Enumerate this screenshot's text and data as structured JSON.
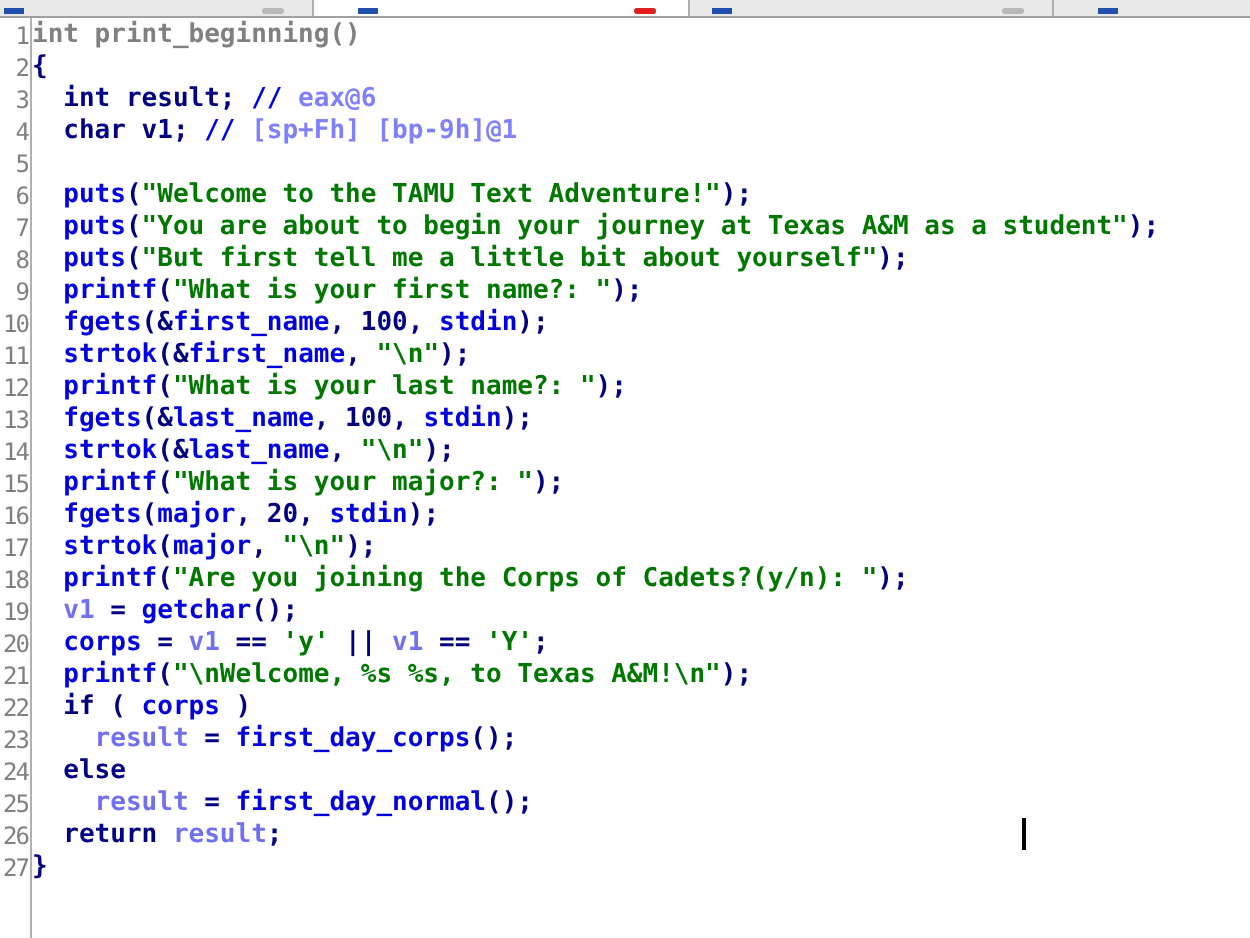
{
  "tabs": [
    {
      "selected": false,
      "closable": true
    },
    {
      "selected": true,
      "closable": true
    },
    {
      "selected": false,
      "closable": true
    },
    {
      "selected": false,
      "closable": false
    }
  ],
  "code_lines": [
    {
      "number": "1",
      "tokens": [
        {
          "kind": "decl",
          "text": "int print_beginning()"
        }
      ]
    },
    {
      "number": "2",
      "tokens": [
        {
          "kind": "plain",
          "text": "{"
        }
      ]
    },
    {
      "number": "3",
      "tokens": [
        {
          "kind": "plain",
          "text": "  int result; "
        },
        {
          "kind": "func",
          "text": "//"
        },
        {
          "kind": "comment",
          "text": " eax@6"
        }
      ]
    },
    {
      "number": "4",
      "tokens": [
        {
          "kind": "plain",
          "text": "  char v1; "
        },
        {
          "kind": "func",
          "text": "//"
        },
        {
          "kind": "comment",
          "text": " [sp+Fh] [bp-9h]@1"
        }
      ]
    },
    {
      "number": "5"
    },
    {
      "number": "6",
      "tokens": [
        {
          "kind": "func",
          "text": "  puts"
        },
        {
          "kind": "plain",
          "text": "("
        },
        {
          "kind": "string",
          "text": "\"Welcome to the TAMU Text Adventure!\""
        },
        {
          "kind": "plain",
          "text": ");"
        }
      ]
    },
    {
      "number": "7",
      "tokens": [
        {
          "kind": "func",
          "text": "  puts"
        },
        {
          "kind": "plain",
          "text": "("
        },
        {
          "kind": "string",
          "text": "\"You are about to begin your journey at Texas A&M as a student\""
        },
        {
          "kind": "plain",
          "text": ");"
        }
      ]
    },
    {
      "number": "8",
      "tokens": [
        {
          "kind": "func",
          "text": "  puts"
        },
        {
          "kind": "plain",
          "text": "("
        },
        {
          "kind": "string",
          "text": "\"But first tell me a little bit about yourself\""
        },
        {
          "kind": "plain",
          "text": ");"
        }
      ]
    },
    {
      "number": "9",
      "tokens": [
        {
          "kind": "func",
          "text": "  printf"
        },
        {
          "kind": "plain",
          "text": "("
        },
        {
          "kind": "string",
          "text": "\"What is your first name?: \""
        },
        {
          "kind": "plain",
          "text": ");"
        }
      ]
    },
    {
      "number": "10",
      "tokens": [
        {
          "kind": "func",
          "text": "  fgets"
        },
        {
          "kind": "plain",
          "text": "(&"
        },
        {
          "kind": "func",
          "text": "first_name"
        },
        {
          "kind": "plain",
          "text": ", 100, "
        },
        {
          "kind": "func",
          "text": "stdin"
        },
        {
          "kind": "plain",
          "text": ");"
        }
      ]
    },
    {
      "number": "11",
      "tokens": [
        {
          "kind": "func",
          "text": "  strtok"
        },
        {
          "kind": "plain",
          "text": "(&"
        },
        {
          "kind": "func",
          "text": "first_name"
        },
        {
          "kind": "plain",
          "text": ", "
        },
        {
          "kind": "string",
          "text": "\"\\n\""
        },
        {
          "kind": "plain",
          "text": ");"
        }
      ]
    },
    {
      "number": "12",
      "tokens": [
        {
          "kind": "func",
          "text": "  printf"
        },
        {
          "kind": "plain",
          "text": "("
        },
        {
          "kind": "string",
          "text": "\"What is your last name?: \""
        },
        {
          "kind": "plain",
          "text": ");"
        }
      ]
    },
    {
      "number": "13",
      "tokens": [
        {
          "kind": "func",
          "text": "  fgets"
        },
        {
          "kind": "plain",
          "text": "(&"
        },
        {
          "kind": "func",
          "text": "last_name"
        },
        {
          "kind": "plain",
          "text": ", 100, "
        },
        {
          "kind": "func",
          "text": "stdin"
        },
        {
          "kind": "plain",
          "text": ");"
        }
      ]
    },
    {
      "number": "14",
      "tokens": [
        {
          "kind": "func",
          "text": "  strtok"
        },
        {
          "kind": "plain",
          "text": "(&"
        },
        {
          "kind": "func",
          "text": "last_name"
        },
        {
          "kind": "plain",
          "text": ", "
        },
        {
          "kind": "string",
          "text": "\"\\n\""
        },
        {
          "kind": "plain",
          "text": ");"
        }
      ]
    },
    {
      "number": "15",
      "tokens": [
        {
          "kind": "func",
          "text": "  printf"
        },
        {
          "kind": "plain",
          "text": "("
        },
        {
          "kind": "string",
          "text": "\"What is your major?: \""
        },
        {
          "kind": "plain",
          "text": ");"
        }
      ]
    },
    {
      "number": "16",
      "tokens": [
        {
          "kind": "func",
          "text": "  fgets"
        },
        {
          "kind": "plain",
          "text": "("
        },
        {
          "kind": "func",
          "text": "major"
        },
        {
          "kind": "plain",
          "text": ", 20, "
        },
        {
          "kind": "func",
          "text": "stdin"
        },
        {
          "kind": "plain",
          "text": ");"
        }
      ]
    },
    {
      "number": "17",
      "tokens": [
        {
          "kind": "func",
          "text": "  strtok"
        },
        {
          "kind": "plain",
          "text": "("
        },
        {
          "kind": "func",
          "text": "major"
        },
        {
          "kind": "plain",
          "text": ", "
        },
        {
          "kind": "string",
          "text": "\"\\n\""
        },
        {
          "kind": "plain",
          "text": ");"
        }
      ]
    },
    {
      "number": "18",
      "tokens": [
        {
          "kind": "func",
          "text": "  printf"
        },
        {
          "kind": "plain",
          "text": "("
        },
        {
          "kind": "string",
          "text": "\"Are you joining the Corps of Cadets?(y/n): \""
        },
        {
          "kind": "plain",
          "text": ");"
        }
      ]
    },
    {
      "number": "19",
      "tokens": [
        {
          "kind": "var",
          "text": "  v1"
        },
        {
          "kind": "plain",
          "text": " = "
        },
        {
          "kind": "func",
          "text": "getchar"
        },
        {
          "kind": "plain",
          "text": "();"
        }
      ]
    },
    {
      "number": "20",
      "tokens": [
        {
          "kind": "func",
          "text": "  corps"
        },
        {
          "kind": "plain",
          "text": " = "
        },
        {
          "kind": "var",
          "text": "v1"
        },
        {
          "kind": "plain",
          "text": " == "
        },
        {
          "kind": "string",
          "text": "'y'"
        },
        {
          "kind": "plain",
          "text": " || "
        },
        {
          "kind": "var",
          "text": "v1"
        },
        {
          "kind": "plain",
          "text": " == "
        },
        {
          "kind": "string",
          "text": "'Y'"
        },
        {
          "kind": "plain",
          "text": ";"
        }
      ]
    },
    {
      "number": "21",
      "tokens": [
        {
          "kind": "func",
          "text": "  printf"
        },
        {
          "kind": "plain",
          "text": "("
        },
        {
          "kind": "string",
          "text": "\"\\nWelcome, %s %s, to Texas A&M!\\n\""
        },
        {
          "kind": "plain",
          "text": ");"
        }
      ]
    },
    {
      "number": "22",
      "tokens": [
        {
          "kind": "plain",
          "text": "  if ( "
        },
        {
          "kind": "func",
          "text": "corps"
        },
        {
          "kind": "plain",
          "text": " )"
        }
      ]
    },
    {
      "number": "23",
      "tokens": [
        {
          "kind": "var",
          "text": "    result"
        },
        {
          "kind": "plain",
          "text": " = "
        },
        {
          "kind": "func",
          "text": "first_day_corps"
        },
        {
          "kind": "plain",
          "text": "();"
        }
      ]
    },
    {
      "number": "24",
      "tokens": [
        {
          "kind": "plain",
          "text": "  else"
        }
      ]
    },
    {
      "number": "25",
      "tokens": [
        {
          "kind": "var",
          "text": "    result"
        },
        {
          "kind": "plain",
          "text": " = "
        },
        {
          "kind": "func",
          "text": "first_day_normal"
        },
        {
          "kind": "plain",
          "text": "();"
        }
      ]
    },
    {
      "number": "26",
      "tokens": [
        {
          "kind": "plain",
          "text": "  return "
        },
        {
          "kind": "var",
          "text": "result"
        },
        {
          "kind": "plain",
          "text": ";"
        }
      ]
    },
    {
      "number": "27",
      "tokens": [
        {
          "kind": "plain",
          "text": "}"
        }
      ]
    }
  ]
}
